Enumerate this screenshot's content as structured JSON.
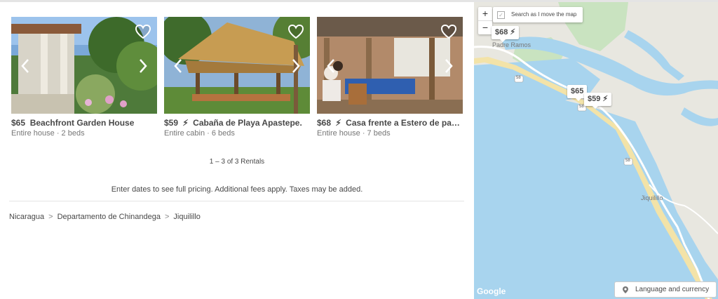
{
  "listings": [
    {
      "price": "$65",
      "instant": false,
      "name": "Beachfront Garden House",
      "details": "Entire house · 2 beds"
    },
    {
      "price": "$59",
      "instant": true,
      "name": "Cabaña de Playa Apastepe.",
      "details": "Entire cabin · 6 beds"
    },
    {
      "price": "$68",
      "instant": true,
      "name": "Casa frente a Estero de padre Ra...",
      "details": "Entire house · 7 beds"
    }
  ],
  "pagination": "1 – 3 of 3 Rentals",
  "pricing_note": "Enter dates to see full pricing. Additional fees apply. Taxes may be added.",
  "breadcrumb": [
    "Nicaragua",
    "Departamento de Chinandega",
    "Jiquilillo"
  ],
  "map": {
    "zoom_in": "+",
    "zoom_out": "−",
    "search_toggle": "Search as I move the map",
    "pins": [
      "$68",
      "$65",
      "$59"
    ],
    "place_labels": [
      "Padre Ramos",
      "Jiquilillo"
    ],
    "road_markers": [
      "58",
      "58",
      "58"
    ],
    "attribution": "Google",
    "language_button": "Language and currency"
  },
  "colors": {
    "water": "#a8d4ee",
    "land": "#e8e7e0",
    "green": "#c9e3c0",
    "sand": "#f3e3a8"
  }
}
